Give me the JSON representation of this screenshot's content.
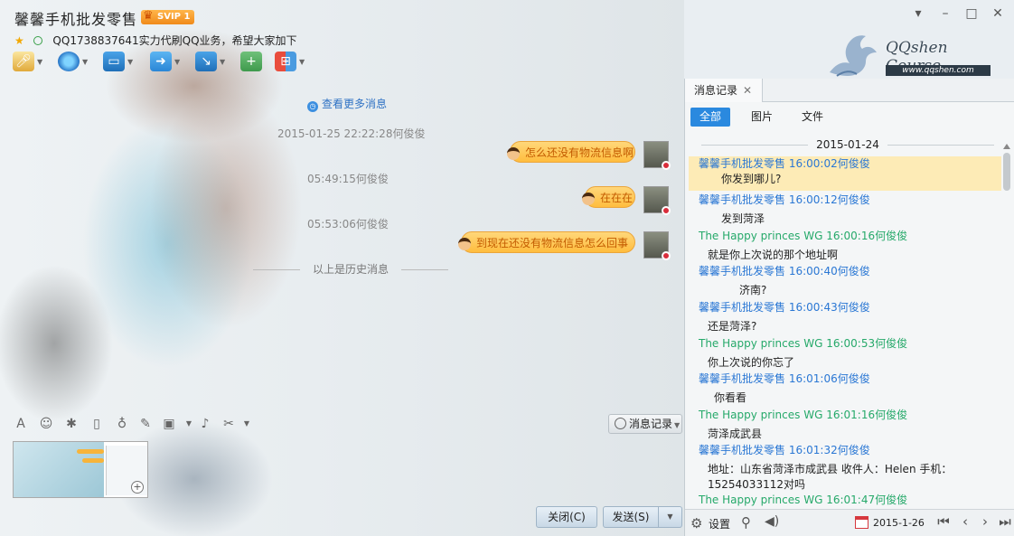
{
  "window": {
    "title": "馨馨手机批发零售",
    "vip_badge": "SVIP 1",
    "signature": "QQ1738837641实力代刷QQ业务，希望大家加下",
    "controls": [
      "▾",
      "–",
      "□",
      "✕"
    ]
  },
  "logo": {
    "brand": "QQshen Course",
    "site": "www.qqshen.com"
  },
  "chat": {
    "more_messages": "查看更多消息",
    "history_divider": "以上是历史消息",
    "items": [
      {
        "time": "2015-01-25 22:22:28何俊俊",
        "text": "怎么还没有物流信息啊"
      },
      {
        "time": "05:49:15何俊俊",
        "text": "在在在"
      },
      {
        "time": "05:53:06何俊俊",
        "text": "到现在还没有物流信息怎么回事"
      }
    ]
  },
  "input": {
    "history_button": "消息记录",
    "close_button": "关闭(C)",
    "send_button": "发送(S)"
  },
  "history_panel": {
    "tab": "消息记录",
    "filters": [
      "全部",
      "图片",
      "文件"
    ],
    "active_filter": "全部",
    "date": "2015-01-24",
    "messages": [
      {
        "sender": "馨馨手机批发零售",
        "time": "16:00:02何俊俊",
        "text": "你发到哪儿?",
        "self": true
      },
      {
        "sender": "馨馨手机批发零售",
        "time": "16:00:12何俊俊",
        "text": "发到菏泽",
        "self": true
      },
      {
        "sender": "The Happy princes  WG",
        "time": "16:00:16何俊俊",
        "text": "就是你上次说的那个地址啊",
        "self": false
      },
      {
        "sender": "馨馨手机批发零售",
        "time": "16:00:40何俊俊",
        "text": "济南?",
        "self": true
      },
      {
        "sender": "馨馨手机批发零售",
        "time": "16:00:43何俊俊",
        "text": "还是菏泽?",
        "self": true
      },
      {
        "sender": "The Happy princes  WG",
        "time": "16:00:53何俊俊",
        "text": "你上次说的你忘了",
        "self": false
      },
      {
        "sender": "馨馨手机批发零售",
        "time": "16:01:06何俊俊",
        "text": "你看看",
        "self": true
      },
      {
        "sender": "The Happy princes  WG",
        "time": "16:01:16何俊俊",
        "text": "菏泽成武县",
        "self": false
      },
      {
        "sender": "馨馨手机批发零售",
        "time": "16:01:32何俊俊",
        "text": "地址：山东省菏泽市成武县 收件人：Helen 手机：15254033112对吗",
        "self": true
      },
      {
        "sender": "The Happy princes  WG",
        "time": "16:01:47何俊俊",
        "text": "",
        "self": false
      }
    ],
    "settings_label": "设置",
    "calendar_date": "2015-1-26"
  },
  "icons": {
    "mic": "microphone-icon",
    "camera": "webcam-icon",
    "screen": "screen-share-icon",
    "folder": "file-transfer-icon",
    "remote": "remote-desktop-icon",
    "chat_add": "add-chat-icon",
    "apps": "apps-icon"
  },
  "colors": {
    "accent": "#2a89df",
    "bubble": "#ffc54f",
    "self_name": "#2a77d4",
    "other_name": "#26a96a",
    "highlight": "#fdebb6"
  }
}
